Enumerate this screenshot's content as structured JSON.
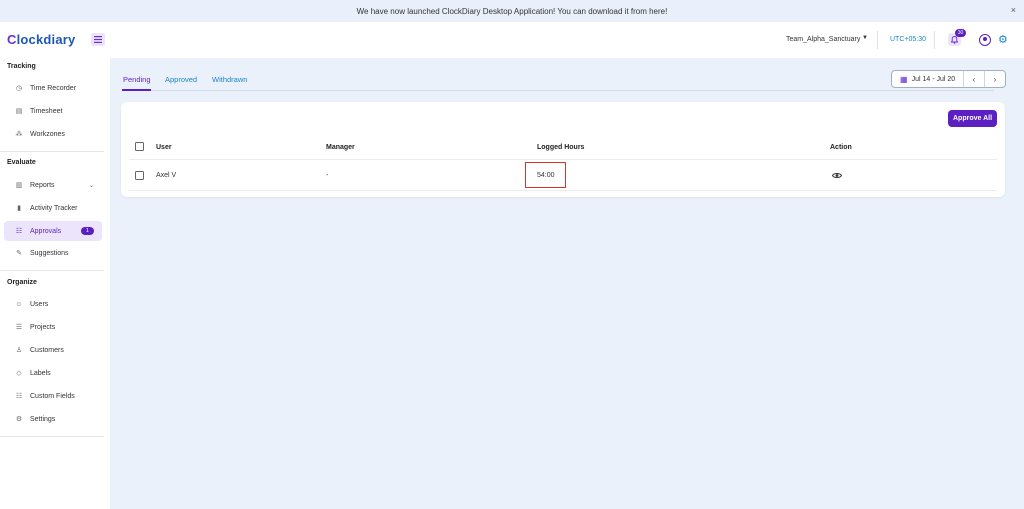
{
  "banner": {
    "text": "We have now launched ClockDiary Desktop Application! You can download it from here!",
    "close": "×"
  },
  "header": {
    "logo_first": "C",
    "logo_rest": "lockdiary",
    "menu_icon": "menu-icon",
    "team": "Team_Alpha_Sanctuary",
    "timezone": "UTC+05:30",
    "notifications_count": "30"
  },
  "sidebar": {
    "sections": [
      "Tracking",
      "Evaluate",
      "Organize"
    ],
    "tracking": [
      {
        "label": "Time Recorder",
        "icon": "clock-icon"
      },
      {
        "label": "Timesheet",
        "icon": "timesheet-icon"
      },
      {
        "label": "Workzones",
        "icon": "workzones-icon"
      }
    ],
    "evaluate": [
      {
        "label": "Reports",
        "icon": "reports-icon"
      },
      {
        "label": "Activity Tracker",
        "icon": "activity-icon"
      },
      {
        "label": "Approvals",
        "icon": "approvals-icon",
        "badge": "1"
      },
      {
        "label": "Suggestions",
        "icon": "suggestions-icon"
      }
    ],
    "organize": [
      {
        "label": "Users",
        "icon": "users-icon"
      },
      {
        "label": "Projects",
        "icon": "projects-icon"
      },
      {
        "label": "Customers",
        "icon": "customers-icon"
      },
      {
        "label": "Labels",
        "icon": "labels-icon"
      },
      {
        "label": "Custom Fields",
        "icon": "custom-fields-icon"
      },
      {
        "label": "Settings",
        "icon": "settings-icon"
      }
    ]
  },
  "main": {
    "tabs": [
      "Pending",
      "Approved",
      "Withdrawn"
    ],
    "active_tab": "Pending",
    "date_range": "Jul 14 - Jul 20",
    "approve_all": "Approve All",
    "table": {
      "headers": [
        "User",
        "Manager",
        "Logged Hours",
        "Action"
      ],
      "rows": [
        {
          "user": "Axel V",
          "manager": "-",
          "logged_hours": "54:00",
          "action": "eye-icon"
        }
      ]
    }
  },
  "colors": {
    "accent": "#5b1fc2",
    "link": "#1b84c6",
    "highlight": "#d9332b",
    "background": "#ebf1fb"
  }
}
